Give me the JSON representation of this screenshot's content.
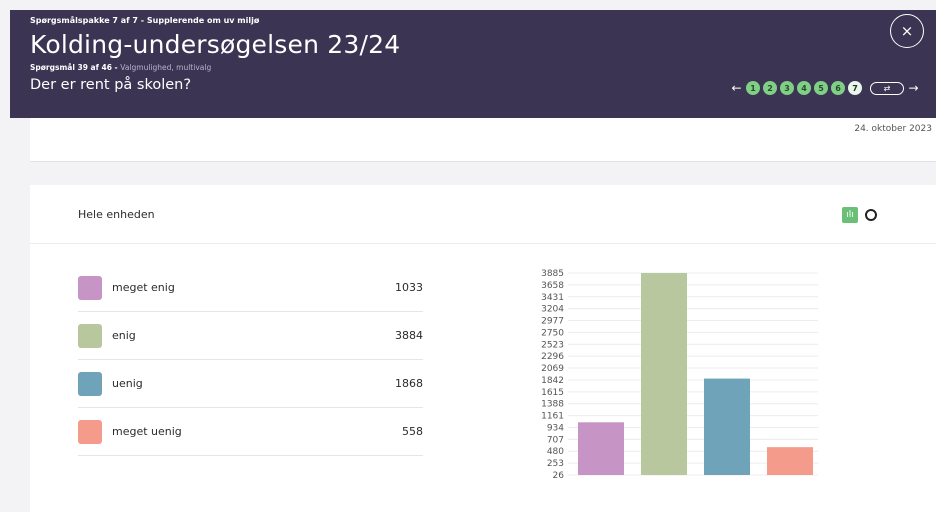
{
  "header": {
    "package": "Spørgsmålspakke 7 af 7 - Supplerende om uv miljø",
    "title": "Kolding-undersøgelsen 23/24",
    "question_counter": "Spørgsmål 39 af 46 -",
    "question_type": "Valgmulighed, multivalg",
    "question": "Der er rent på skolen?",
    "close_icon": "×",
    "prev_arrow": "←",
    "next_arrow": "→",
    "pages": [
      "1",
      "2",
      "3",
      "4",
      "5",
      "6",
      "7"
    ],
    "current_page": "7",
    "toggle_icon": "⇄"
  },
  "date": "24. oktober 2023",
  "section": {
    "unit_label": "Hele enheden",
    "bar_view_icon": "bar-chart",
    "donut_view_icon": "donut-chart"
  },
  "legend": [
    {
      "label": "meget enig",
      "value": "1033",
      "color": "#c794c6"
    },
    {
      "label": "enig",
      "value": "3884",
      "color": "#b8c79e"
    },
    {
      "label": "uenig",
      "value": "1868",
      "color": "#6fa3b9"
    },
    {
      "label": "meget uenig",
      "value": "558",
      "color": "#f59b8c"
    }
  ],
  "chart_data": {
    "type": "bar",
    "categories": [
      "meget enig",
      "enig",
      "uenig",
      "meget uenig"
    ],
    "values": [
      1033,
      3884,
      1868,
      558
    ],
    "colors": [
      "#c794c6",
      "#b8c79e",
      "#6fa3b9",
      "#f59b8c"
    ],
    "yticks": [
      "3885",
      "3658",
      "3431",
      "3204",
      "2977",
      "2750",
      "2523",
      "2296",
      "2069",
      "1842",
      "1615",
      "1388",
      "1161",
      "934",
      "707",
      "480",
      "253",
      "26"
    ],
    "ylim": [
      26,
      3885
    ],
    "grid": true
  }
}
